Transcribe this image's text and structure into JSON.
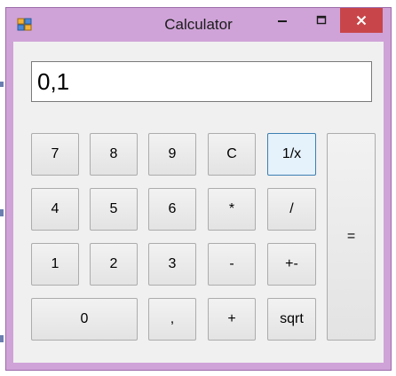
{
  "window": {
    "title": "Calculator",
    "controls": {
      "minimize": "minimize",
      "maximize": "maximize",
      "close": "close"
    }
  },
  "display": {
    "value": "0,1"
  },
  "buttons": {
    "seven": "7",
    "eight": "8",
    "nine": "9",
    "clear": "C",
    "reciprocal": "1/x",
    "four": "4",
    "five": "5",
    "six": "6",
    "multiply": "*",
    "divide": "/",
    "one": "1",
    "two": "2",
    "three": "3",
    "subtract": "-",
    "negate": "+-",
    "zero": "0",
    "decimal": ",",
    "add": "+",
    "sqrt": "sqrt",
    "equals": "="
  },
  "colors": {
    "frame": "#cfa3d8",
    "close_button": "#c8464a",
    "client": "#f0f0f0",
    "focused_button": "#e5f1fb"
  }
}
